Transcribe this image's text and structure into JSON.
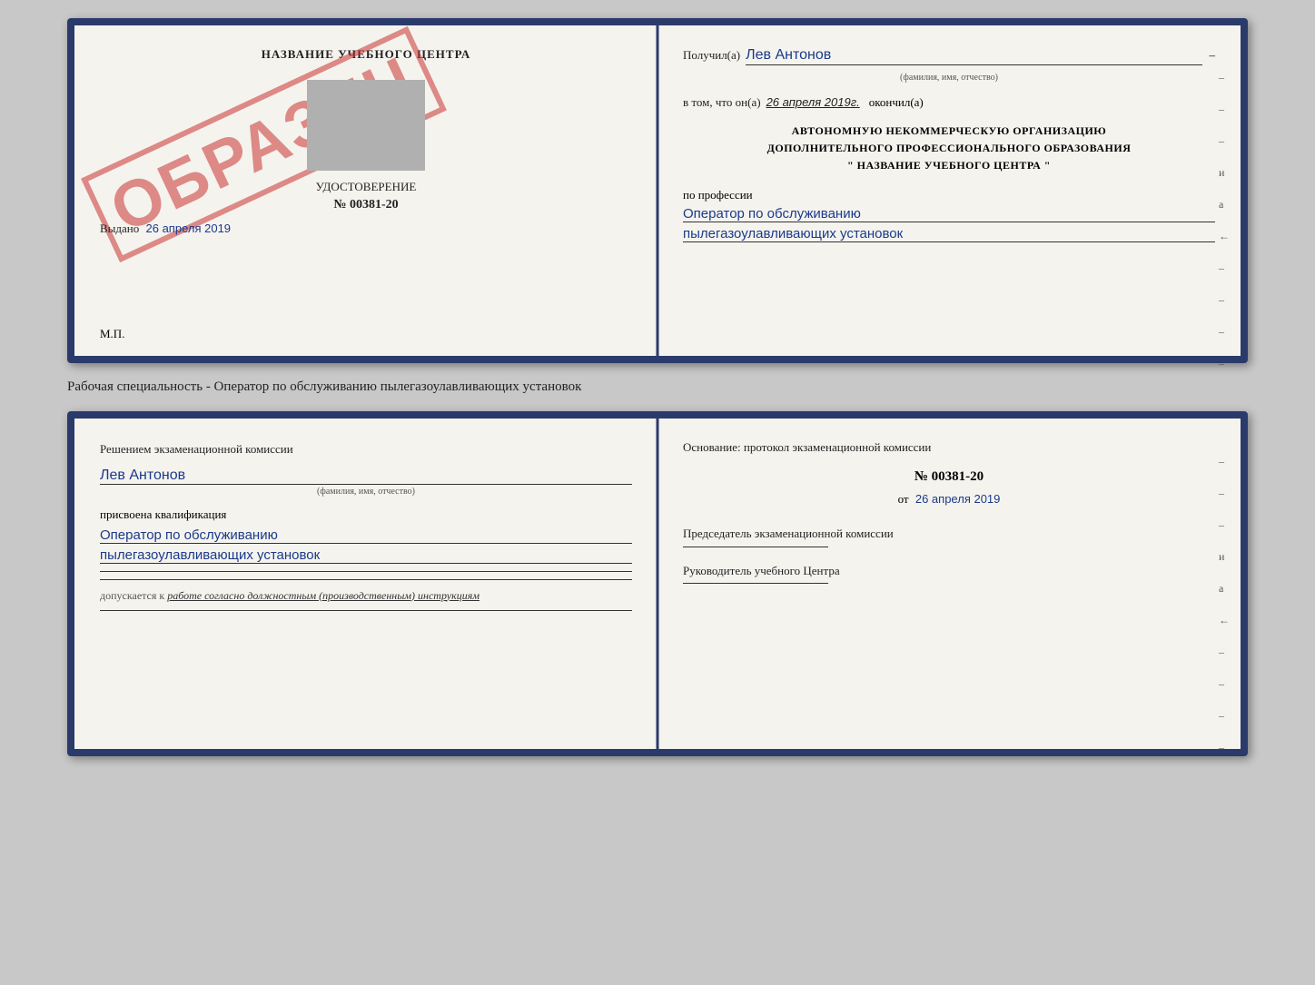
{
  "cert": {
    "left": {
      "title": "НАЗВАНИЕ УЧЕБНОГО ЦЕНТРА",
      "udost": "УДОСТОВЕРЕНИЕ",
      "number": "№ 00381-20",
      "vydano_label": "Выдано",
      "vydano_date": "26 апреля 2019",
      "mp": "М.П.",
      "stamp_text": "ОБРАЗЕЦ"
    },
    "right": {
      "poluchil_label": "Получил(а)",
      "poluchil_value": "Лев Антонов",
      "poluchil_sub": "(фамилия, имя, отчество)",
      "vtom_label": "в том, что он(а)",
      "vtom_date": "26 апреля 2019г.",
      "okonchil_label": "окончил(а)",
      "org_line1": "АВТОНОМНУЮ НЕКОММЕРЧЕСКУЮ ОРГАНИЗАЦИЮ",
      "org_line2": "ДОПОЛНИТЕЛЬНОГО ПРОФЕССИОНАЛЬНОГО ОБРАЗОВАНИЯ",
      "org_line3": "\" НАЗВАНИЕ УЧЕБНОГО ЦЕНТРА \"",
      "po_professii": "по профессии",
      "profession1": "Оператор по обслуживанию",
      "profession2": "пылегазоулавливающих установок",
      "dashes": [
        "-",
        "-",
        "-",
        "и",
        "а",
        "←",
        "-",
        "-",
        "-",
        "-"
      ]
    }
  },
  "middle_text": "Рабочая специальность - Оператор по обслуживанию пылегазоулавливающих установок",
  "bottom": {
    "left": {
      "reshen_title": "Решением экзаменационной комиссии",
      "name_value": "Лев Антонов",
      "name_sub": "(фамилия, имя, отчество)",
      "prisvoena": "присвоена квалификация",
      "kval1": "Оператор по обслуживанию",
      "kval2": "пылегазоулавливающих установок",
      "dopusk_label": "допускается к",
      "dopusk_value": "работе согласно должностным (производственным) инструкциям"
    },
    "right": {
      "osnov": "Основание: протокол экзаменационной комиссии",
      "num": "№ 00381-20",
      "ot_label": "от",
      "ot_date": "26 апреля 2019",
      "pred_label": "Председатель экзаменационной комиссии",
      "ruk_label": "Руководитель учебного Центра",
      "dashes": [
        "-",
        "-",
        "-",
        "и",
        "а",
        "←",
        "-",
        "-",
        "-",
        "-"
      ]
    }
  }
}
